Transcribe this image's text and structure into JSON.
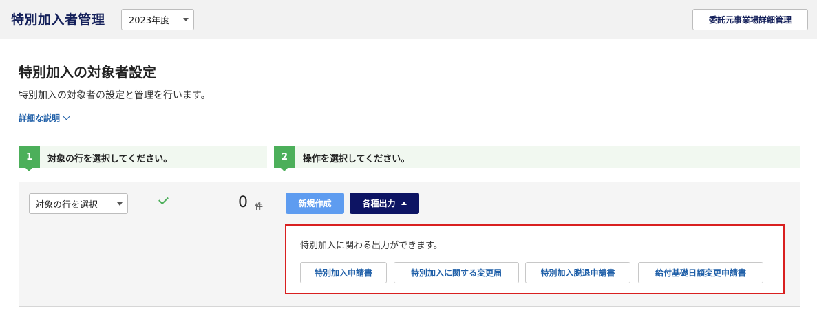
{
  "header": {
    "app_title": "特別加入者管理",
    "year_value": "2023年度",
    "right_button": "委託元事業場詳細管理"
  },
  "main": {
    "title": "特別加入の対象者設定",
    "description": "特別加入の対象者の設定と管理を行います。",
    "detail_link": "詳細な説明"
  },
  "steps": [
    {
      "num": "1",
      "label": "対象の行を選択してください。"
    },
    {
      "num": "2",
      "label": "操作を選択してください。"
    }
  ],
  "selection": {
    "select_value": "対象の行を選択",
    "count": "0",
    "count_unit": "件"
  },
  "actions": {
    "new_label": "新規作成",
    "output_label": "各種出力"
  },
  "output_menu": {
    "description": "特別加入に関わる出力ができます。",
    "buttons": [
      "特別加入申請書",
      "特別加入に関する変更届",
      "特別加入脱退申請書",
      "給付基礎日額変更申請書"
    ]
  },
  "colors": {
    "brand_navy": "#14205a",
    "step_green": "#4caf5a",
    "primary_blue": "#5e9cf0",
    "highlight_red": "#d92020"
  }
}
